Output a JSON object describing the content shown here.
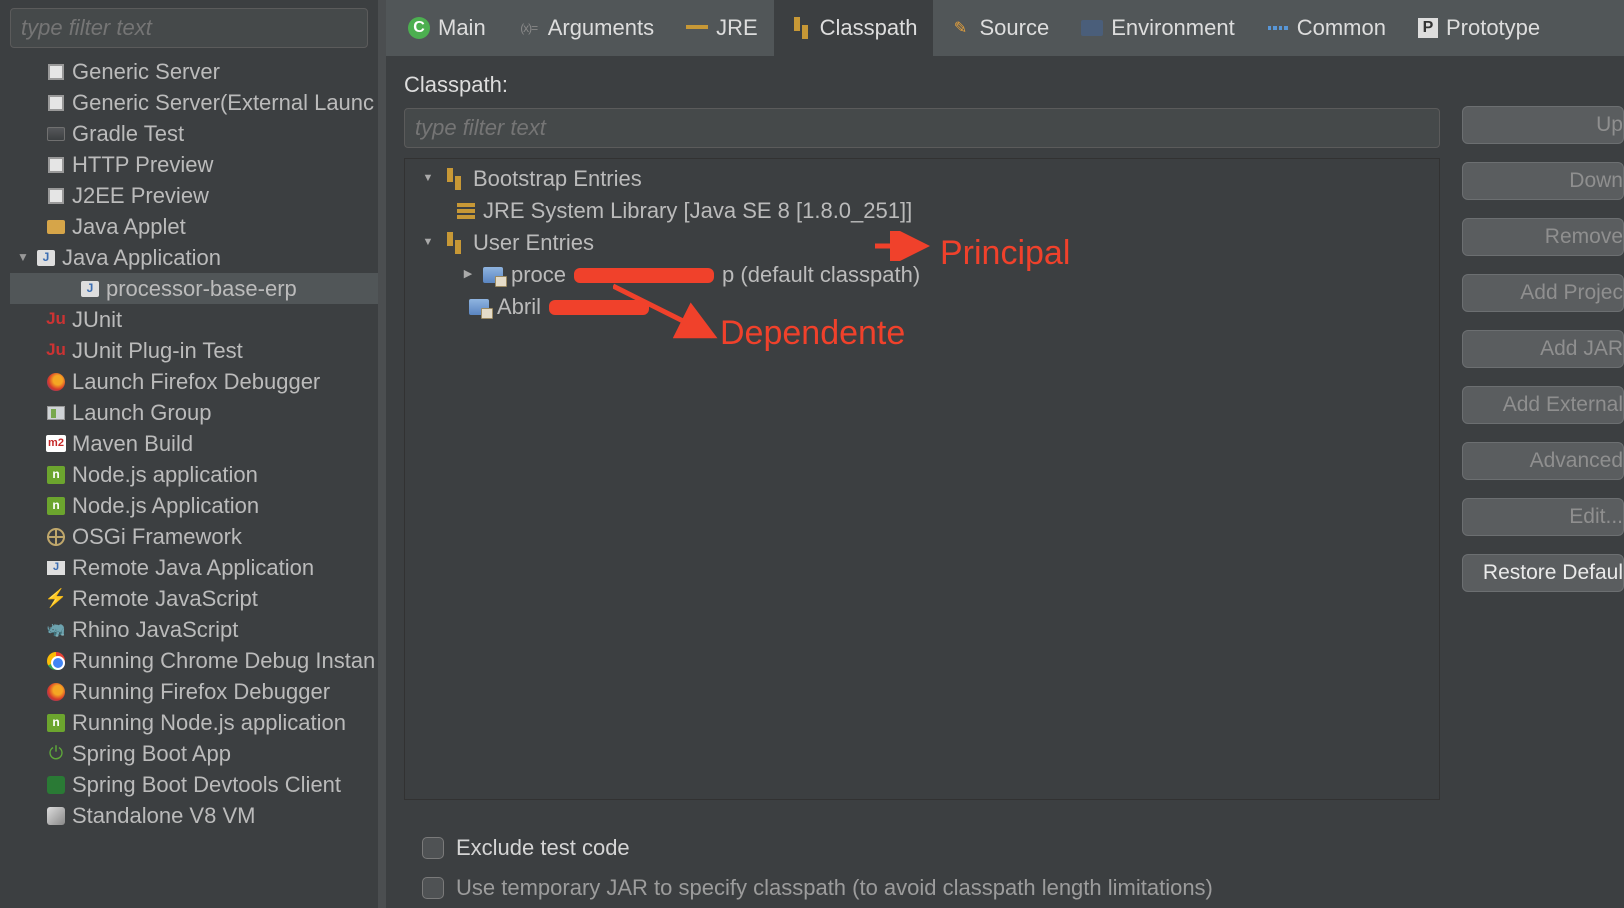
{
  "sidebar": {
    "filter_placeholder": "type filter text",
    "items": [
      {
        "label": "Generic Server",
        "icon": "box",
        "indent": 1
      },
      {
        "label": "Generic Server(External Launc",
        "icon": "box",
        "indent": 1
      },
      {
        "label": "Gradle Test",
        "icon": "grad",
        "indent": 1
      },
      {
        "label": "HTTP Preview",
        "icon": "box",
        "indent": 1
      },
      {
        "label": "J2EE Preview",
        "icon": "box",
        "indent": 1
      },
      {
        "label": "Java Applet",
        "icon": "applet",
        "indent": 1
      },
      {
        "label": "Java Application",
        "icon": "j",
        "indent": 0,
        "expanded": true
      },
      {
        "label": "processor-base-erp",
        "icon": "j",
        "indent": 2,
        "selected": true
      },
      {
        "label": "JUnit",
        "icon": "ju",
        "indent": 1
      },
      {
        "label": "JUnit Plug-in Test",
        "icon": "ju",
        "indent": 1
      },
      {
        "label": "Launch Firefox Debugger",
        "icon": "ff",
        "indent": 1
      },
      {
        "label": "Launch Group",
        "icon": "grp",
        "indent": 1
      },
      {
        "label": "Maven Build",
        "icon": "m2",
        "indent": 1
      },
      {
        "label": "Node.js application",
        "icon": "node",
        "indent": 1
      },
      {
        "label": "Node.js Application",
        "icon": "node",
        "indent": 1
      },
      {
        "label": "OSGi Framework",
        "icon": "osgi",
        "indent": 1
      },
      {
        "label": "Remote Java Application",
        "icon": "rj",
        "indent": 1
      },
      {
        "label": "Remote JavaScript",
        "icon": "bolt",
        "indent": 1
      },
      {
        "label": "Rhino JavaScript",
        "icon": "rhino",
        "indent": 1
      },
      {
        "label": "Running Chrome Debug Instan",
        "icon": "chrome",
        "indent": 1
      },
      {
        "label": "Running Firefox Debugger",
        "icon": "ff",
        "indent": 1
      },
      {
        "label": "Running Node.js application",
        "icon": "node",
        "indent": 1
      },
      {
        "label": "Spring Boot App",
        "icon": "power",
        "indent": 1
      },
      {
        "label": "Spring Boot Devtools Client",
        "icon": "dev",
        "indent": 1
      },
      {
        "label": "Standalone V8 VM",
        "icon": "v8",
        "indent": 1
      }
    ]
  },
  "tabs": [
    {
      "label": "Main",
      "icon": "main-c"
    },
    {
      "label": "Arguments",
      "icon": "args"
    },
    {
      "label": "JRE",
      "icon": "jre"
    },
    {
      "label": "Classpath",
      "icon": "cp",
      "active": true
    },
    {
      "label": "Source",
      "icon": "src"
    },
    {
      "label": "Environment",
      "icon": "env"
    },
    {
      "label": "Common",
      "icon": "common"
    },
    {
      "label": "Prototype",
      "icon": "proto"
    }
  ],
  "classpath": {
    "label": "Classpath:",
    "filter_placeholder": "type filter text",
    "bootstrap_label": "Bootstrap Entries",
    "jre_label": "JRE System Library [Java SE 8 [1.8.0_251]]",
    "user_label": "User Entries",
    "entry1_prefix": "proce",
    "entry1_suffix": "p (default classpath)",
    "entry2_prefix": "Abril"
  },
  "buttons": [
    "Up",
    "Down",
    "Remove",
    "Add Projec",
    "Add JAR",
    "Add External",
    "Advanced",
    "Edit...",
    "Restore Defaul"
  ],
  "checks": {
    "exclude": "Exclude test code",
    "temp": "Use temporary JAR to specify classpath (to avoid classpath length limitations)"
  },
  "annotations": {
    "principal": "Principal",
    "dependente": "Dependente"
  }
}
